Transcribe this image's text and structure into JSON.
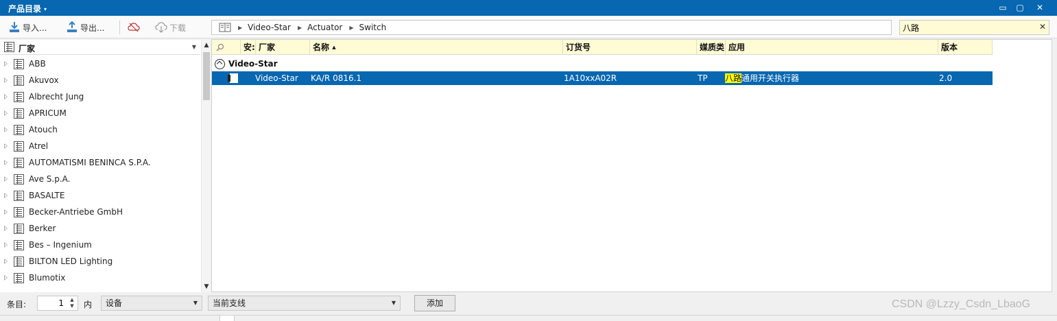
{
  "titlebar": {
    "title": "产品目录",
    "caret": "▾",
    "minimize": "▭",
    "restore": "▢",
    "close": "✕"
  },
  "toolbar": {
    "import_label": "导入...",
    "export_label": "导出...",
    "download_label": "下载"
  },
  "breadcrumb": {
    "items": [
      "Video-Star",
      "Actuator",
      "Switch"
    ],
    "sep": "▶"
  },
  "search": {
    "value": "八路",
    "clear": "✕"
  },
  "manufacturers": {
    "header": "厂家",
    "items": [
      "ABB",
      "Akuvox",
      "Albrecht Jung",
      "APRICUM",
      "Atouch",
      "Atrel",
      "AUTOMATISMI BENINCA S.P.A.",
      "Ave S.p.A.",
      "BASALTE",
      "Becker-Antriebe GmbH",
      "Berker",
      "Bes – Ingenium",
      "BILTON LED Lighting",
      "Blumotix"
    ]
  },
  "grid": {
    "columns": {
      "safe": "安:",
      "manufacturer": "厂家",
      "name": "名称",
      "order_no": "订货号",
      "medium": "媒质类",
      "application": "应用",
      "version": "版本"
    },
    "sort_arrow": "▲",
    "group": "Video-Star",
    "row": {
      "manufacturer": "Video-Star",
      "name": "KA/R 0816.1",
      "order_no": "1A10xxA02R",
      "medium": "TP",
      "application_highlight": "八路",
      "application_rest": "通用开关执行器",
      "version": "2.0"
    }
  },
  "status": {
    "count_label": "条目:",
    "count_value": "1",
    "in_label": "内",
    "scope_dropdown": "设备",
    "line_dropdown": "当前支线",
    "add_button": "添加"
  },
  "watermark": "CSDN @Lzzy_Csdn_LbaoG",
  "colors": {
    "accent": "#0767b0",
    "header_bg": "#fffbd5",
    "highlight": "#ffff00"
  }
}
